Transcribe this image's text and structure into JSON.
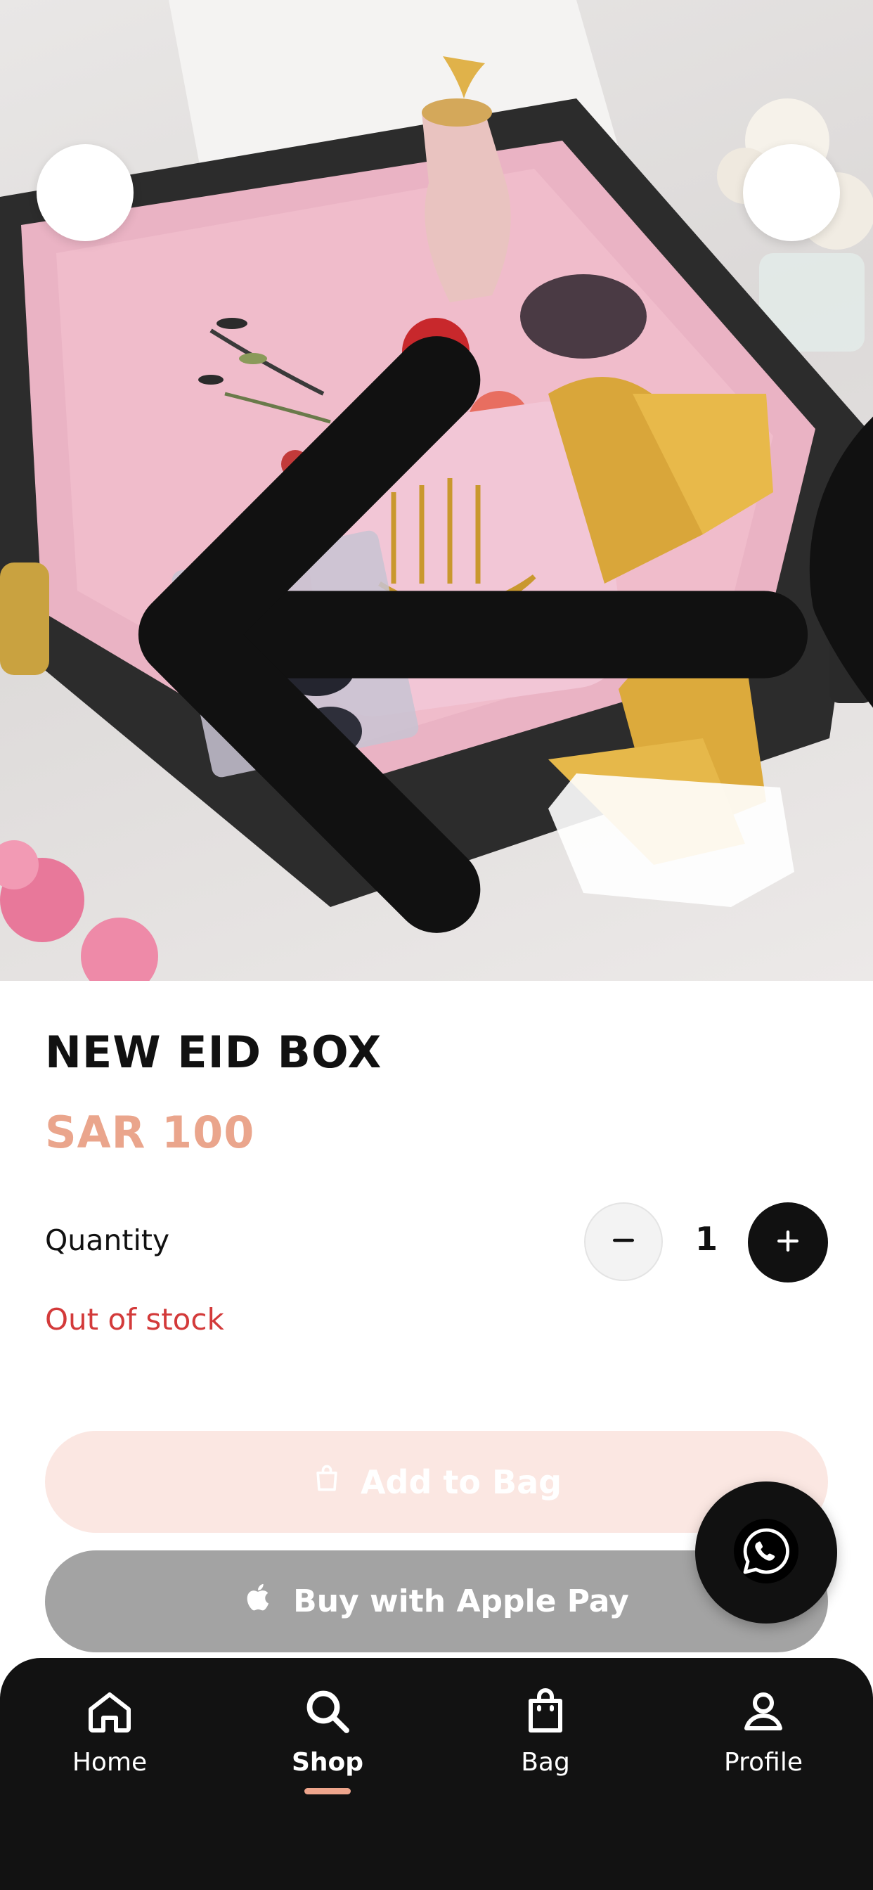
{
  "product": {
    "title": "NEW EID BOX",
    "price": "SAR 100",
    "quantity_label": "Quantity",
    "quantity_value": "1",
    "stock_status": "Out of stock"
  },
  "actions": {
    "add_to_bag": "Add to Bag",
    "apple_pay": "Buy with Apple Pay"
  },
  "nav": {
    "items": [
      {
        "label": "Home",
        "icon": "home-icon"
      },
      {
        "label": "Shop",
        "icon": "search-icon",
        "active": true
      },
      {
        "label": "Bag",
        "icon": "bag-icon"
      },
      {
        "label": "Profile",
        "icon": "profile-icon"
      }
    ]
  },
  "colors": {
    "price": "#eaa58c",
    "out_of_stock": "#d33a3a",
    "add_to_bag_bg": "#fbe7e2",
    "apple_pay_bg": "#a3a3a3",
    "nav_bg": "#121212",
    "nav_active_indicator": "#eea58c"
  }
}
